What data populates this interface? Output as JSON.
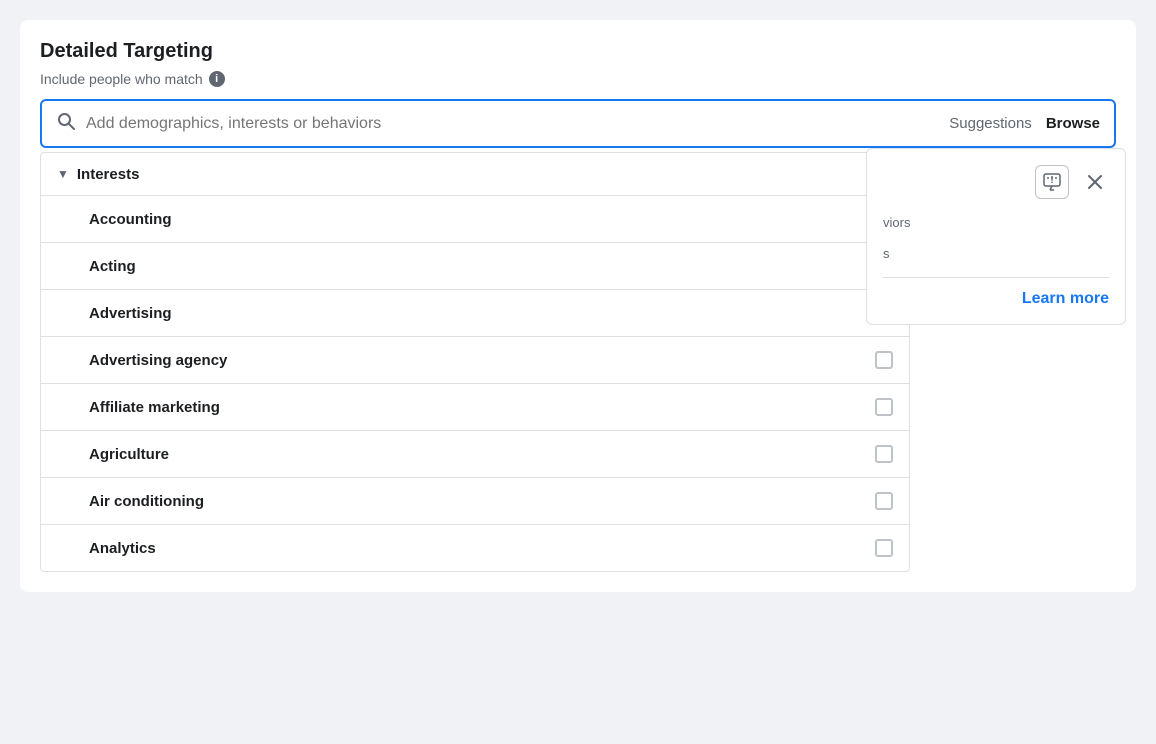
{
  "page": {
    "title": "Detailed Targeting",
    "subtitle": "Include people who match",
    "search": {
      "placeholder": "Add demographics, interests or behaviors",
      "suggestions_label": "Suggestions",
      "browse_label": "Browse"
    },
    "dropdown": {
      "title": "Interests",
      "items": [
        {
          "id": "accounting",
          "label": "Accounting"
        },
        {
          "id": "acting",
          "label": "Acting"
        },
        {
          "id": "advertising",
          "label": "Advertising"
        },
        {
          "id": "advertising-agency",
          "label": "Advertising agency"
        },
        {
          "id": "affiliate-marketing",
          "label": "Affiliate marketing"
        },
        {
          "id": "agriculture",
          "label": "Agriculture"
        },
        {
          "id": "air-conditioning",
          "label": "Air conditioning"
        },
        {
          "id": "analytics",
          "label": "Analytics"
        }
      ]
    },
    "side_panel": {
      "truncated_text_1": "viors",
      "truncated_text_2": "s",
      "feedback_icon": "feedback",
      "close_icon": "close",
      "learn_more_label": "Learn more"
    }
  }
}
